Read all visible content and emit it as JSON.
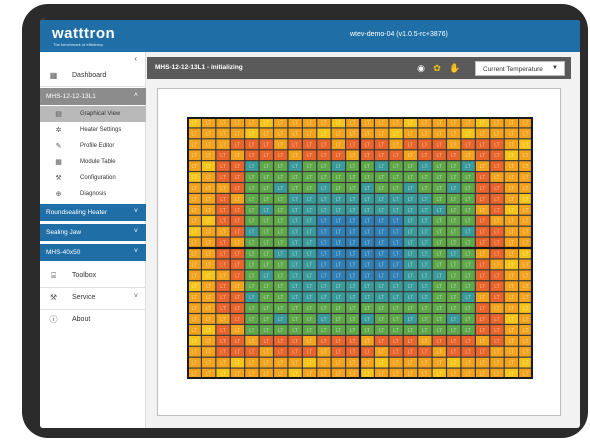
{
  "app": {
    "brand": "watttron",
    "tagline": "The benchmark of efficiency",
    "version": "wtev-demo-04 (v1.0.5-rc+3876)"
  },
  "sidebar": {
    "collapse_icon": "chevron-left-icon",
    "dashboard": {
      "label": "Dashboard",
      "icon": "dashboard-icon"
    },
    "active_group": {
      "label": "MHS-12-12-13L1",
      "expanded": true
    },
    "subitems": [
      {
        "label": "Graphical View",
        "icon": "grid-view-icon",
        "active": true
      },
      {
        "label": "Heater Settings",
        "icon": "gear-icon"
      },
      {
        "label": "Profile Editor",
        "icon": "pencil-icon"
      },
      {
        "label": "Module Table",
        "icon": "table-icon"
      },
      {
        "label": "Configuration",
        "icon": "wrench-icon"
      },
      {
        "label": "Diagnosis",
        "icon": "magnifier-icon"
      }
    ],
    "groups": [
      {
        "label": "Roundsealing Heater"
      },
      {
        "label": "Sealing Jaw"
      },
      {
        "label": "MHS-40x50"
      }
    ],
    "bottom_items": [
      {
        "label": "Toolbox",
        "icon": "toolbox-icon"
      },
      {
        "label": "Service",
        "icon": "wrench-icon",
        "has_chevron": true
      },
      {
        "label": "About",
        "icon": "info-icon"
      }
    ]
  },
  "main": {
    "title": "MHS-12-12-13L1 - initializing",
    "tools": [
      "eye-icon",
      "palette-icon",
      "hand-icon"
    ],
    "view_select": {
      "value": "Current Temperature"
    }
  },
  "heatmap": {
    "rows": 24,
    "cols": 24,
    "cell_label": "LT",
    "legend_colors": {
      "orange": "#f2a31b",
      "red": "#e8642a",
      "yellow": "#f5c417",
      "green": "#5fa84a",
      "teal": "#3a9a9a",
      "blue": "#2f7fb4"
    },
    "block_dividers": {
      "cols": [
        12,
        24
      ],
      "rows": [
        12
      ]
    }
  },
  "colors": {
    "topbar": "#1f6fa6",
    "group_active": "#8c8c8c",
    "group_blue": "#1f6fa6",
    "subbar": "#5a5a5a"
  }
}
